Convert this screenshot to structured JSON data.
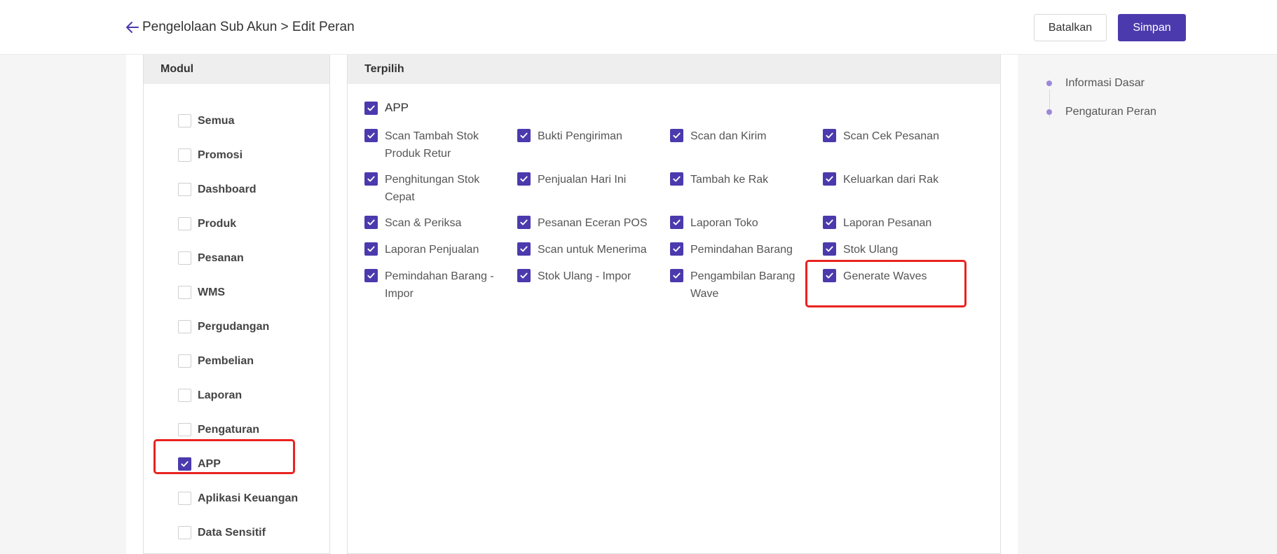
{
  "header": {
    "title": "Pengelolaan Sub Akun > Edit Peran",
    "cancel_label": "Batalkan",
    "save_label": "Simpan"
  },
  "modul": {
    "heading": "Modul",
    "items": [
      {
        "label": "Semua",
        "checked": false
      },
      {
        "label": "Promosi",
        "checked": false
      },
      {
        "label": "Dashboard",
        "checked": false
      },
      {
        "label": "Produk",
        "checked": false
      },
      {
        "label": "Pesanan",
        "checked": false
      },
      {
        "label": "WMS",
        "checked": false
      },
      {
        "label": "Pergudangan",
        "checked": false
      },
      {
        "label": "Pembelian",
        "checked": false
      },
      {
        "label": "Laporan",
        "checked": false
      },
      {
        "label": "Pengaturan",
        "checked": false
      },
      {
        "label": "APP",
        "checked": true
      },
      {
        "label": "Aplikasi Keuangan",
        "checked": false
      },
      {
        "label": "Data Sensitif",
        "checked": false
      }
    ]
  },
  "terpilih": {
    "heading": "Terpilih",
    "group_label": "APP",
    "permissions": [
      "Scan Tambah Stok Produk Retur",
      "Bukti Pengiriman",
      "Scan dan Kirim",
      "Scan Cek Pesanan",
      "Penghitungan Stok Cepat",
      "Penjualan Hari Ini",
      "Tambah ke Rak",
      "Keluarkan dari Rak",
      "Scan & Periksa",
      "Pesanan Eceran POS",
      "Laporan Toko",
      "Laporan Pesanan",
      "Laporan Penjualan",
      "Scan untuk Menerima",
      "Pemindahan Barang",
      "Stok Ulang",
      "Pemindahan Barang - Impor",
      "Stok Ulang - Impor",
      "Pengambilan Barang Wave",
      "Generate Waves"
    ]
  },
  "side_nav": {
    "items": [
      "Informasi Dasar",
      "Pengaturan Peran"
    ]
  },
  "colors": {
    "accent": "#4b3aad",
    "highlight": "#e8231f",
    "nav_dot": "#9c88d8"
  }
}
